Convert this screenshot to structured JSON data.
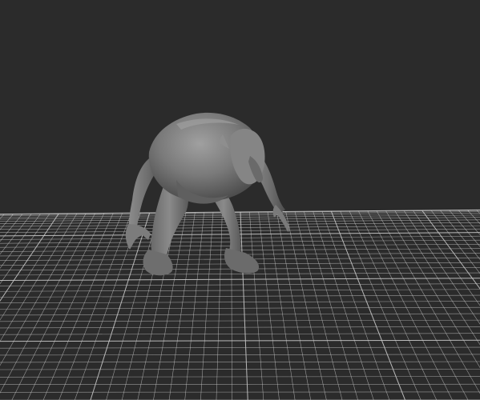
{
  "viewport": {
    "background_color": "#2b2b2b",
    "grid_color": "#c9c9c9",
    "grid_on": true,
    "model_color": "#7a7a7a",
    "model_shadow_color": "#4a4a4a",
    "model_highlight_color": "#9a9a9a",
    "model_type": "creature-mesh"
  }
}
